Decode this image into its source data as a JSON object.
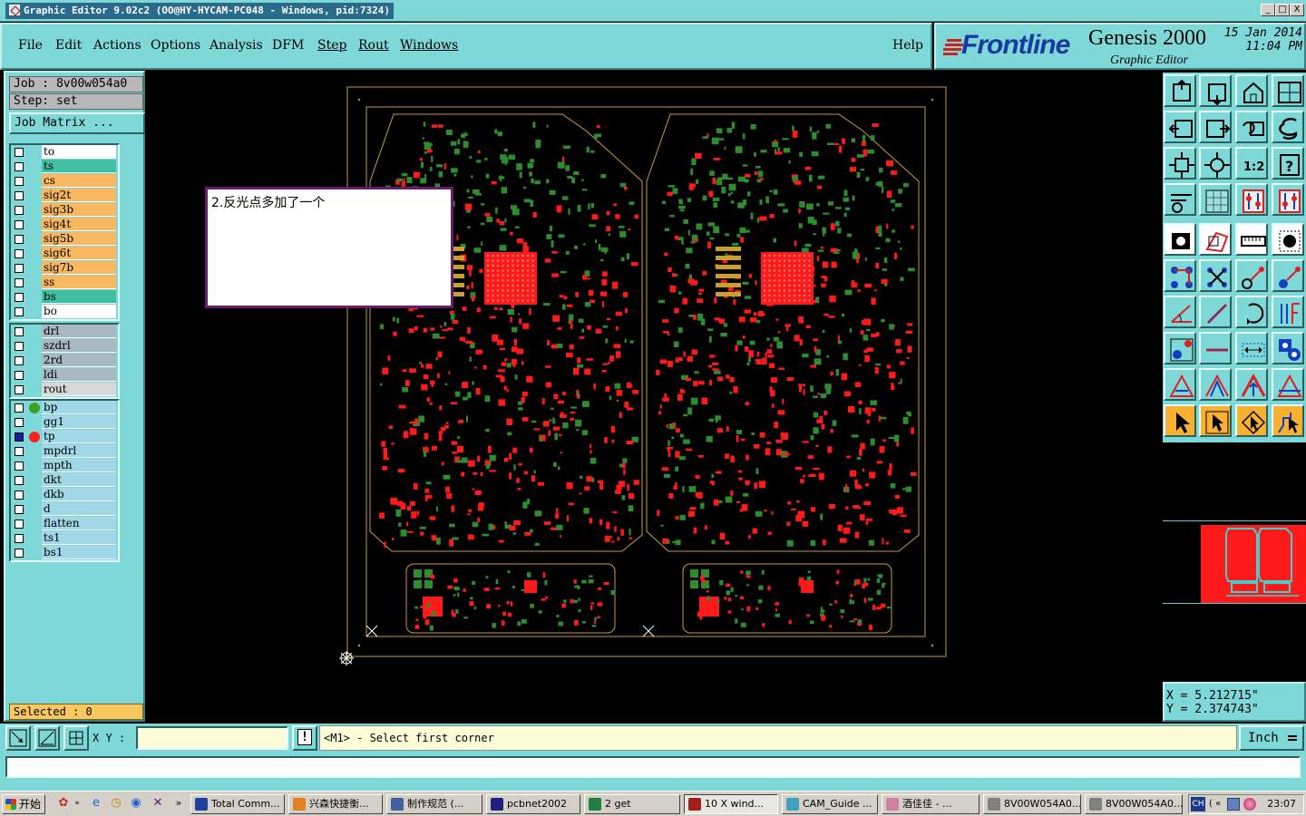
{
  "window": {
    "title": "Graphic Editor 9.02c2  (OO@HY-HYCAM-PC048 - Windows, pid:7324)",
    "minimize": "_",
    "maximize": "□",
    "close": "X"
  },
  "menu": {
    "items": [
      "File",
      "Edit",
      "Actions",
      "Options",
      "Analysis",
      "DFM",
      "Step",
      "Rout",
      "Windows"
    ],
    "help": "Help"
  },
  "brand": {
    "logo": "Frontline",
    "product": "Genesis 2000",
    "subtitle": "Graphic Editor",
    "date": "15 Jan 2014",
    "time": "11:04 PM"
  },
  "job": {
    "job_line": "Job : 8v00w054a0",
    "step_line": "Step: set",
    "matrix_button": "Job Matrix ..."
  },
  "layers": {
    "board": [
      {
        "name": "to",
        "color": "#ffffff"
      },
      {
        "name": "ts",
        "color": "#40c0a0"
      },
      {
        "name": "cs",
        "color": "#f8b860"
      },
      {
        "name": "sig2t",
        "color": "#f8b860"
      },
      {
        "name": "sig3b",
        "color": "#f8b860"
      },
      {
        "name": "sig4t",
        "color": "#f8b860"
      },
      {
        "name": "sig5b",
        "color": "#f8b860"
      },
      {
        "name": "sig6t",
        "color": "#f8b860"
      },
      {
        "name": "sig7b",
        "color": "#f8b860"
      },
      {
        "name": "ss",
        "color": "#f8b860"
      },
      {
        "name": "bs",
        "color": "#40c0a0"
      },
      {
        "name": "bo",
        "color": "#ffffff"
      }
    ],
    "drill": [
      {
        "name": "drl",
        "color": "#a8b8c0"
      },
      {
        "name": "szdrl",
        "color": "#a8b8c0"
      },
      {
        "name": "2rd",
        "color": "#a8b8c0"
      },
      {
        "name": "ldi",
        "color": "#a8b8c0"
      },
      {
        "name": "rout",
        "color": "#d8d8d8"
      }
    ],
    "misc": [
      {
        "name": "bp",
        "color": "#a0d8e8",
        "dot": "#40a020"
      },
      {
        "name": "gg1",
        "color": "#a0d8e8"
      },
      {
        "name": "tp",
        "color": "#a0d8e8",
        "dot": "#ff2020",
        "checked": true,
        "mark": "⊞"
      },
      {
        "name": "mpdrl",
        "color": "#a0d8e8"
      },
      {
        "name": "mpth",
        "color": "#a0d8e8"
      },
      {
        "name": "dkt",
        "color": "#a0d8e8"
      },
      {
        "name": "dkb",
        "color": "#a0d8e8"
      },
      {
        "name": "d",
        "color": "#a0d8e8"
      },
      {
        "name": "flatten",
        "color": "#a0d8e8"
      },
      {
        "name": "ts1",
        "color": "#a0d8e8"
      },
      {
        "name": "bs1",
        "color": "#a0d8e8"
      }
    ]
  },
  "selected": "Selected : 0",
  "note": "2.反光点多加了一个",
  "coords": {
    "x": "X = 5.212715\"",
    "y": "Y = 2.374743\""
  },
  "command": {
    "xy_label": "X Y :",
    "xy_value": "",
    "excl": "!",
    "prompt": "<M1> - Select first corner",
    "units": "Inch"
  },
  "colors": {
    "panel": "#7fd8d8",
    "copper": "#ff1a1a",
    "mask": "#2e8b2e",
    "outline": "#c89a40"
  },
  "taskbar": {
    "start": "开始",
    "tasks": [
      {
        "label": "Total Comm...",
        "icon": "disk-icon"
      },
      {
        "label": "兴森快捷衡...",
        "icon": "star-icon"
      },
      {
        "label": "制作规范 (...",
        "icon": "doc-icon"
      },
      {
        "label": "pcbnet2002",
        "icon": "app-icon"
      },
      {
        "label": "2 get",
        "icon": "chat-icon"
      },
      {
        "label": "10 X wind...",
        "icon": "x-icon"
      },
      {
        "label": "CAM_Guide ...",
        "icon": "cam-icon"
      },
      {
        "label": "酒佳佳 - ...",
        "icon": "user-icon"
      },
      {
        "label": "8V00W054A0...",
        "icon": "window-icon"
      },
      {
        "label": "8V00W054A0...",
        "icon": "window-icon"
      }
    ],
    "tray_lang": "CH",
    "clock": "23:07"
  }
}
